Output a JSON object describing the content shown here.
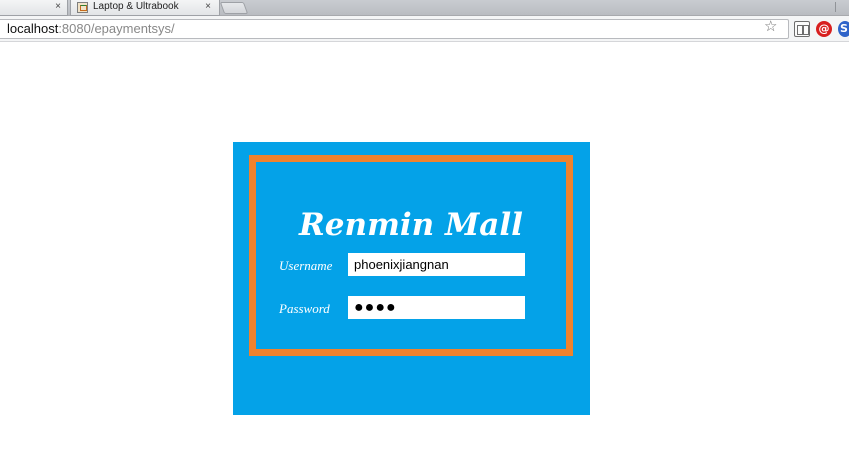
{
  "browser": {
    "tabs": [
      {
        "label": "",
        "close": "×"
      },
      {
        "label": "Laptop & Ultrabook",
        "close": "×",
        "favicon": "laptop-favicon"
      }
    ],
    "address": {
      "host": "localhost",
      "rest": ":8080/epaymentsys/"
    },
    "toolbar_icons": [
      "bookmark-star-icon",
      "reader-icon",
      "at-extension-icon",
      "extension-icon"
    ],
    "at_glyph": "@",
    "ext_glyph": "S"
  },
  "login": {
    "brand": "Renmin Mall",
    "username_label": "Username",
    "username_value": "phoenixjiangnan",
    "password_label": "Password",
    "password_value": "●●●●"
  },
  "colors": {
    "card_background": "#04a2e8",
    "frame_border": "#f0822d",
    "text_white": "#ffffff"
  }
}
